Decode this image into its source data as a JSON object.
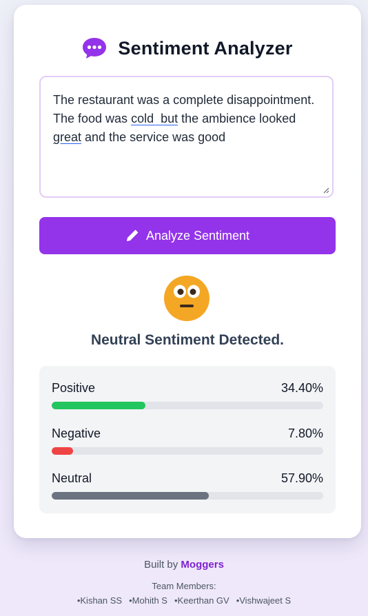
{
  "app": {
    "title": "Sentiment Analyzer",
    "icon": "chat-bubble-icon",
    "accent_color": "#9333ea"
  },
  "input": {
    "line1": "The restaurant was a complete disappointment.",
    "line2_pre": "The food was ",
    "line2_flag": "cold  but",
    "line2_post": " the ambience looked",
    "line3_flag": "great",
    "line3_post": " and the service was good"
  },
  "button": {
    "label": "Analyze Sentiment",
    "icon": "pencil-icon"
  },
  "result": {
    "emoji": "neutral-face-icon",
    "heading": "Neutral Sentiment Detected."
  },
  "scores": [
    {
      "label": "Positive",
      "value": "34.40%",
      "fraction": 0.344,
      "color": "#22c55e"
    },
    {
      "label": "Negative",
      "value": "7.80%",
      "fraction": 0.078,
      "color": "#ef4444"
    },
    {
      "label": "Neutral",
      "value": "57.90%",
      "fraction": 0.579,
      "color": "#6b7280"
    }
  ],
  "footer": {
    "built_by_prefix": "Built by ",
    "brand": "Moggers",
    "team_label": "Team Members:",
    "members": [
      "Kishan SS",
      "Mohith S",
      "Keerthan GV",
      "Vishwajeet S"
    ]
  }
}
